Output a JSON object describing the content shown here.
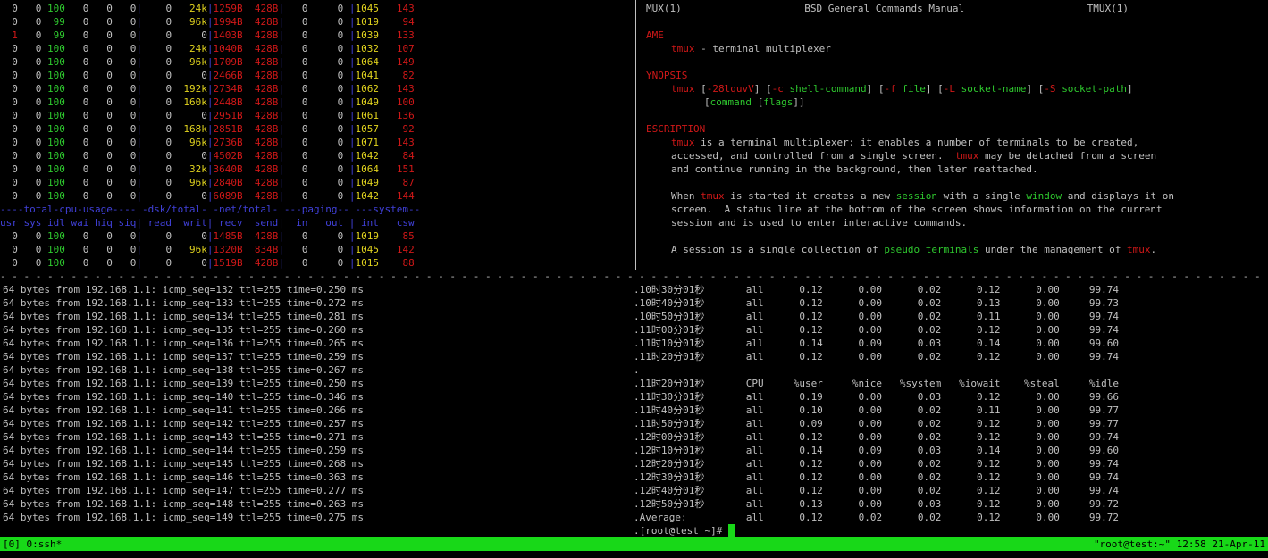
{
  "dstat": {
    "rows1": [
      {
        "usr": "0",
        "sys": "0",
        "idl": "100",
        "wai": "0",
        "hiq": "0",
        "siq": "0",
        "read": "0",
        "writ": "24k",
        "recv": "1259B",
        "send": "428B",
        "in": "0",
        "out": "0",
        "int": "1045",
        "csw": "143"
      },
      {
        "usr": "0",
        "sys": "0",
        "idl": "99",
        "wai": "0",
        "hiq": "0",
        "siq": "0",
        "read": "0",
        "writ": "96k",
        "recv": "1994B",
        "send": "428B",
        "in": "0",
        "out": "0",
        "int": "1019",
        "csw": "94"
      },
      {
        "usr": "1",
        "sys": "0",
        "idl": "99",
        "wai": "0",
        "hiq": "0",
        "siq": "0",
        "read": "0",
        "writ": "0",
        "recv": "1403B",
        "send": "428B",
        "in": "0",
        "out": "0",
        "int": "1039",
        "csw": "133"
      },
      {
        "usr": "0",
        "sys": "0",
        "idl": "100",
        "wai": "0",
        "hiq": "0",
        "siq": "0",
        "read": "0",
        "writ": "24k",
        "recv": "1040B",
        "send": "428B",
        "in": "0",
        "out": "0",
        "int": "1032",
        "csw": "107"
      },
      {
        "usr": "0",
        "sys": "0",
        "idl": "100",
        "wai": "0",
        "hiq": "0",
        "siq": "0",
        "read": "0",
        "writ": "96k",
        "recv": "1709B",
        "send": "428B",
        "in": "0",
        "out": "0",
        "int": "1064",
        "csw": "149"
      },
      {
        "usr": "0",
        "sys": "0",
        "idl": "100",
        "wai": "0",
        "hiq": "0",
        "siq": "0",
        "read": "0",
        "writ": "0",
        "recv": "2466B",
        "send": "428B",
        "in": "0",
        "out": "0",
        "int": "1041",
        "csw": "82"
      },
      {
        "usr": "0",
        "sys": "0",
        "idl": "100",
        "wai": "0",
        "hiq": "0",
        "siq": "0",
        "read": "0",
        "writ": "192k",
        "recv": "2734B",
        "send": "428B",
        "in": "0",
        "out": "0",
        "int": "1062",
        "csw": "143"
      },
      {
        "usr": "0",
        "sys": "0",
        "idl": "100",
        "wai": "0",
        "hiq": "0",
        "siq": "0",
        "read": "0",
        "writ": "160k",
        "recv": "2448B",
        "send": "428B",
        "in": "0",
        "out": "0",
        "int": "1049",
        "csw": "100"
      },
      {
        "usr": "0",
        "sys": "0",
        "idl": "100",
        "wai": "0",
        "hiq": "0",
        "siq": "0",
        "read": "0",
        "writ": "0",
        "recv": "2951B",
        "send": "428B",
        "in": "0",
        "out": "0",
        "int": "1061",
        "csw": "136"
      },
      {
        "usr": "0",
        "sys": "0",
        "idl": "100",
        "wai": "0",
        "hiq": "0",
        "siq": "0",
        "read": "0",
        "writ": "168k",
        "recv": "2851B",
        "send": "428B",
        "in": "0",
        "out": "0",
        "int": "1057",
        "csw": "92"
      },
      {
        "usr": "0",
        "sys": "0",
        "idl": "100",
        "wai": "0",
        "hiq": "0",
        "siq": "0",
        "read": "0",
        "writ": "96k",
        "recv": "2736B",
        "send": "428B",
        "in": "0",
        "out": "0",
        "int": "1071",
        "csw": "143"
      },
      {
        "usr": "0",
        "sys": "0",
        "idl": "100",
        "wai": "0",
        "hiq": "0",
        "siq": "0",
        "read": "0",
        "writ": "0",
        "recv": "4502B",
        "send": "428B",
        "in": "0",
        "out": "0",
        "int": "1042",
        "csw": "84"
      },
      {
        "usr": "0",
        "sys": "0",
        "idl": "100",
        "wai": "0",
        "hiq": "0",
        "siq": "0",
        "read": "0",
        "writ": "32k",
        "recv": "3640B",
        "send": "428B",
        "in": "0",
        "out": "0",
        "int": "1064",
        "csw": "151"
      },
      {
        "usr": "0",
        "sys": "0",
        "idl": "100",
        "wai": "0",
        "hiq": "0",
        "siq": "0",
        "read": "0",
        "writ": "96k",
        "recv": "2840B",
        "send": "428B",
        "in": "0",
        "out": "0",
        "int": "1049",
        "csw": "87"
      },
      {
        "usr": "0",
        "sys": "0",
        "idl": "100",
        "wai": "0",
        "hiq": "0",
        "siq": "0",
        "read": "0",
        "writ": "0",
        "recv": "6089B",
        "send": "428B",
        "in": "0",
        "out": "0",
        "int": "1042",
        "csw": "144"
      }
    ],
    "group_header": "----total-cpu-usage---- -dsk/total- -net/total- ---paging-- ---system--",
    "col_header": "usr sys idl wai hiq siq| read  writ| recv  send|  in   out | int   csw ",
    "rows2": [
      {
        "usr": "0",
        "sys": "0",
        "idl": "100",
        "wai": "0",
        "hiq": "0",
        "siq": "0",
        "read": "0",
        "writ": "0",
        "recv": "1485B",
        "send": "428B",
        "in": "0",
        "out": "0",
        "int": "1019",
        "csw": "85"
      },
      {
        "usr": "0",
        "sys": "0",
        "idl": "100",
        "wai": "0",
        "hiq": "0",
        "siq": "0",
        "read": "0",
        "writ": "96k",
        "recv": "1320B",
        "send": "834B",
        "in": "0",
        "out": "0",
        "int": "1045",
        "csw": "142"
      },
      {
        "usr": "0",
        "sys": "0",
        "idl": "100",
        "wai": "0",
        "hiq": "0",
        "siq": "0",
        "read": "0",
        "writ": "0",
        "recv": "1519B",
        "send": "428B",
        "in": "0",
        "out": "0",
        "int": "1015",
        "csw": "88"
      }
    ]
  },
  "man": {
    "title_left": "MUX(1)",
    "title_center": "BSD General Commands Manual",
    "title_right": "TMUX(1)",
    "name_heading": "AME",
    "name_cmd": "tmux",
    "name_desc": " - terminal multiplexer",
    "synopsis_heading": "YNOPSIS",
    "syn1": {
      "cmd": "tmux",
      "p1": " [",
      "o1": "-28lquvV",
      "p2": "] [",
      "o2": "-c",
      "p3": " ",
      "a2": "shell-command",
      "p4": "] [",
      "o3": "-f",
      "p5": " ",
      "a3": "file",
      "p6": "] [",
      "o4": "-L",
      "p7": " ",
      "a4": "socket-name",
      "p8": "] [",
      "o5": "-S",
      "p9": " ",
      "a5": "socket-path",
      "p10": "]"
    },
    "syn2": {
      "p1": "[",
      "a1": "command",
      "p2": " [",
      "a2": "flags",
      "p3": "]]"
    },
    "desc_heading": "ESCRIPTION",
    "d1": {
      "cmd": "tmux",
      "rest": " is a terminal multiplexer: it enables a number of terminals to be created,"
    },
    "d2": {
      "pre": "accessed, and controlled from a single screen.  ",
      "cmd": "tmux",
      "rest": " may be detached from a screen"
    },
    "d3": "and continue running in the background, then later reattached.",
    "d4": {
      "pre": "When ",
      "cmd": "tmux",
      "mid1": " is started it creates a new ",
      "kw1": "session",
      "mid2": " with a single ",
      "kw2": "window",
      "rest": " and displays it on"
    },
    "d5": "screen.  A status line at the bottom of the screen shows information on the current",
    "d6": "session and is used to enter interactive commands.",
    "d7": {
      "pre": "A session is a single collection of ",
      "kw": "pseudo terminals",
      "mid": " under the management of ",
      "cmd": "tmux",
      "rest": "."
    }
  },
  "separator": "- - - - - - - - - - - - - - - - - - - - - - - - - - - - - - - - - - - - - - - - - - - - - - - - - - - - - - - - - - - - - - - - - - - - - - - - - - - - - - - - - - - - - - - - - - - - - - - - - - - - - - - - - - - - - - - - - - - - - - - - - - - - - - - - - - - - - - -",
  "ping": [
    "64 bytes from 192.168.1.1: icmp_seq=132 ttl=255 time=0.250 ms",
    "64 bytes from 192.168.1.1: icmp_seq=133 ttl=255 time=0.272 ms",
    "64 bytes from 192.168.1.1: icmp_seq=134 ttl=255 time=0.281 ms",
    "64 bytes from 192.168.1.1: icmp_seq=135 ttl=255 time=0.260 ms",
    "64 bytes from 192.168.1.1: icmp_seq=136 ttl=255 time=0.265 ms",
    "64 bytes from 192.168.1.1: icmp_seq=137 ttl=255 time=0.259 ms",
    "64 bytes from 192.168.1.1: icmp_seq=138 ttl=255 time=0.267 ms",
    "64 bytes from 192.168.1.1: icmp_seq=139 ttl=255 time=0.250 ms",
    "64 bytes from 192.168.1.1: icmp_seq=140 ttl=255 time=0.346 ms",
    "64 bytes from 192.168.1.1: icmp_seq=141 ttl=255 time=0.266 ms",
    "64 bytes from 192.168.1.1: icmp_seq=142 ttl=255 time=0.257 ms",
    "64 bytes from 192.168.1.1: icmp_seq=143 ttl=255 time=0.271 ms",
    "64 bytes from 192.168.1.1: icmp_seq=144 ttl=255 time=0.259 ms",
    "64 bytes from 192.168.1.1: icmp_seq=145 ttl=255 time=0.268 ms",
    "64 bytes from 192.168.1.1: icmp_seq=146 ttl=255 time=0.363 ms",
    "64 bytes from 192.168.1.1: icmp_seq=147 ttl=255 time=0.277 ms",
    "64 bytes from 192.168.1.1: icmp_seq=148 ttl=255 time=0.263 ms",
    "64 bytes from 192.168.1.1: icmp_seq=149 ttl=255 time=0.275 ms"
  ],
  "sar": [
    ".10时30分01秒       all      0.12      0.00      0.02      0.12      0.00     99.74",
    ".10时40分01秒       all      0.12      0.00      0.02      0.13      0.00     99.73",
    ".10时50分01秒       all      0.12      0.00      0.02      0.11      0.00     99.74",
    ".11时00分01秒       all      0.12      0.00      0.02      0.12      0.00     99.74",
    ".11时10分01秒       all      0.14      0.09      0.03      0.14      0.00     99.60",
    ".11时20分01秒       all      0.12      0.00      0.02      0.12      0.00     99.74",
    ".",
    ".11时20分01秒       CPU     %user     %nice   %system   %iowait    %steal     %idle",
    ".11时30分01秒       all      0.19      0.00      0.03      0.12      0.00     99.66",
    ".11时40分01秒       all      0.10      0.00      0.02      0.11      0.00     99.77",
    ".11时50分01秒       all      0.09      0.00      0.02      0.12      0.00     99.77",
    ".12时00分01秒       all      0.12      0.00      0.02      0.12      0.00     99.74",
    ".12时10分01秒       all      0.14      0.09      0.03      0.14      0.00     99.60",
    ".12时20分01秒       all      0.12      0.00      0.02      0.12      0.00     99.74",
    ".12时30分01秒       all      0.12      0.00      0.02      0.12      0.00     99.74",
    ".12时40分01秒       all      0.12      0.00      0.02      0.12      0.00     99.74",
    ".12时50分01秒       all      0.13      0.00      0.03      0.12      0.00     99.72",
    ".Average:          all      0.12      0.02      0.02      0.12      0.00     99.72"
  ],
  "prompt": ".[root@test ~]# ",
  "status": {
    "left": "[0] 0:ssh*",
    "right": "\"root@test:~\" 12:58 21-Apr-11"
  }
}
